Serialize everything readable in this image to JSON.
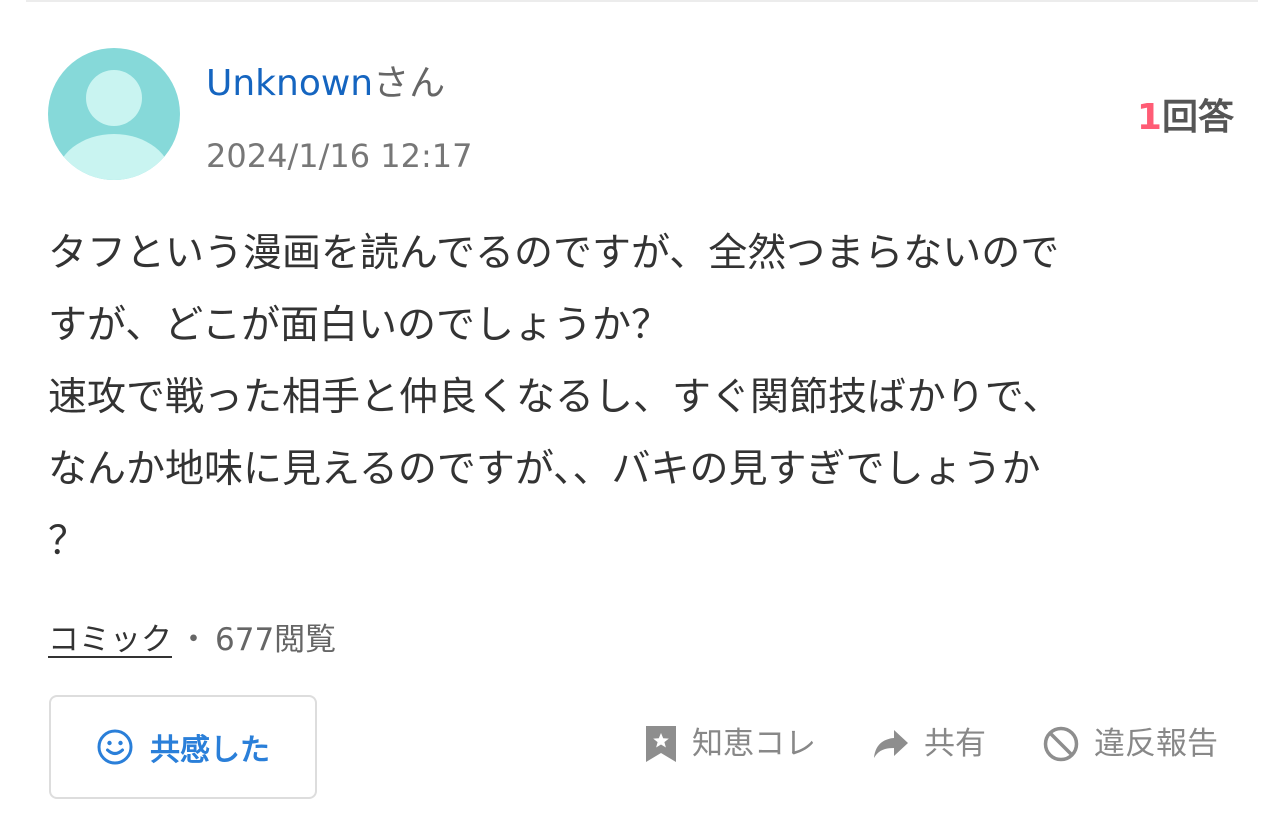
{
  "user": {
    "name": "Unknown",
    "suffix": "さん",
    "date": "2024/1/16 12:17"
  },
  "answers": {
    "count": "1",
    "label": "回答"
  },
  "question": {
    "lines": [
      "タフという漫画を読んでるのですが、全然つまらないので",
      "すが、どこが面白いのでしょうか？",
      "速攻で戦った相手と仲良くなるし、すぐ関節技ばかりで、",
      "なんか地味に見えるのですが、、バキの見すぎでしょうか",
      "？"
    ]
  },
  "meta": {
    "category": "コミック",
    "separator": "・",
    "views": "677閲覧"
  },
  "buttons": {
    "empathy_label": "共感した"
  },
  "actions": {
    "bookmark_label": "知恵コレ",
    "share_label": "共有",
    "report_label": "違反報告"
  },
  "colors": {
    "accent_blue": "#2a7fd9",
    "username_blue": "#1565c0",
    "answer_count_pink": "#ff5c75",
    "avatar_teal": "#86d9d9"
  },
  "icons": {
    "empathy": "smile-icon",
    "bookmark": "bookmark-star-icon",
    "share": "share-arrow-icon",
    "report": "prohibited-icon"
  }
}
